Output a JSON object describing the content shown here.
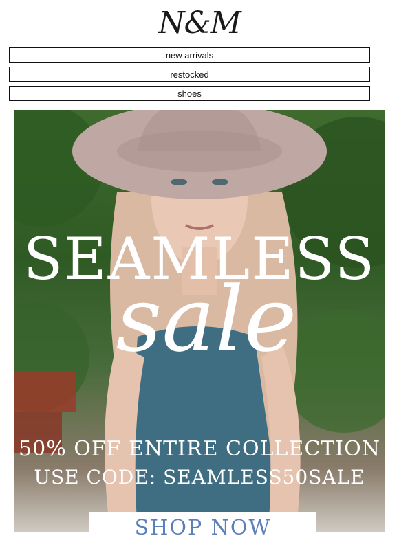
{
  "brand": {
    "logo_text": "N&M"
  },
  "nav": {
    "items": [
      {
        "label": "new arrivals"
      },
      {
        "label": "restocked"
      },
      {
        "label": "shoes"
      }
    ]
  },
  "hero": {
    "headline": "SEAMLESS",
    "script_word": "sale",
    "offer_line": "50% OFF ENTIRE COLLECTION",
    "code_line": "USE CODE: SEAMLESS50SALE",
    "cta_label": "SHOP NOW"
  },
  "colors": {
    "background": "#ffffff",
    "cta_text": "#5b7fb8",
    "nav_border": "#111111"
  }
}
